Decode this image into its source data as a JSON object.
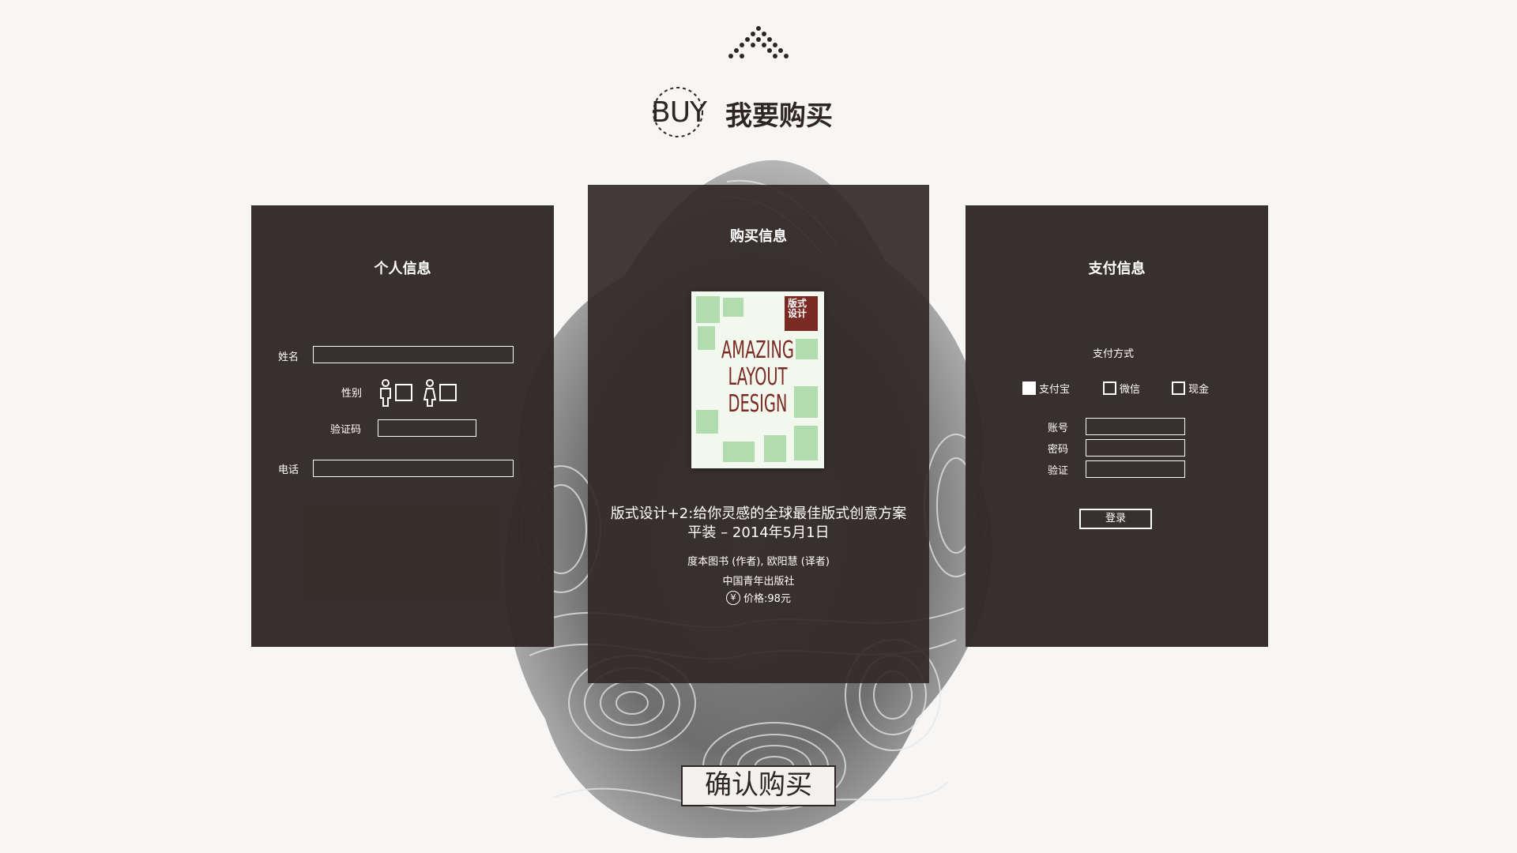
{
  "header": {
    "badge_text": "BUY",
    "title": "我要购买"
  },
  "personal": {
    "title": "个人信息",
    "name_label": "姓名",
    "gender_label": "性别",
    "captcha_label": "验证码",
    "phone_label": "电话"
  },
  "purchase": {
    "title": "购买信息",
    "book": {
      "cover_label": "版式设计",
      "cover_title_lines": [
        "AMAZING",
        "LAYOUT",
        "DESIGN"
      ],
      "title_line1": "版式设计+2:给你灵感的全球最佳版式创意方案",
      "title_line2": "平装 – 2014年5月1日",
      "authors": "度本图书 (作者), 欧阳慧 (译者)",
      "publisher": "中国青年出版社",
      "price": "价格:98元",
      "currency_symbol": "¥"
    }
  },
  "payment": {
    "title": "支付信息",
    "method_label": "支付方式",
    "options": [
      {
        "label": "支付宝",
        "checked": true
      },
      {
        "label": "微信",
        "checked": false
      },
      {
        "label": "现金",
        "checked": false
      }
    ],
    "account_label": "账号",
    "password_label": "密码",
    "verify_label": "验证",
    "login_label": "登录"
  },
  "confirm_label": "确认购买",
  "colors": {
    "panel": "#322927",
    "background": "#f7f6f4",
    "accent_dark": "#2e2624",
    "book_red": "#7a2a22"
  }
}
